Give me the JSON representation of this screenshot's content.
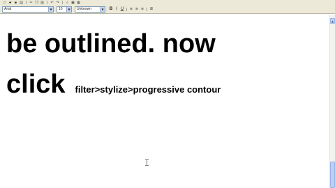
{
  "toolbar_top": {
    "buttons": [
      {
        "name": "new-icon",
        "glyph": "▭"
      },
      {
        "name": "open-icon",
        "glyph": "▰"
      },
      {
        "name": "save-icon",
        "glyph": "▪"
      },
      {
        "name": "print-icon",
        "glyph": "▤"
      },
      {
        "name": "cut-icon",
        "glyph": "✂"
      },
      {
        "name": "copy-icon",
        "glyph": "❐"
      },
      {
        "name": "paste-icon",
        "glyph": "▥"
      },
      {
        "name": "undo-icon",
        "glyph": "↶"
      },
      {
        "name": "redo-icon",
        "glyph": "↷"
      },
      {
        "name": "find-icon",
        "glyph": "⌕"
      },
      {
        "name": "image-icon",
        "glyph": "▣"
      },
      {
        "name": "table-icon",
        "glyph": "▦"
      }
    ]
  },
  "format_bar": {
    "font_value": "Arial",
    "size_value": "10",
    "color_value": "Unknown",
    "bold_label": "B",
    "italic_label": "I",
    "underline_label": "U",
    "align_left_glyph": "≡",
    "align_center_glyph": "≡",
    "align_right_glyph": "≡",
    "bullets_glyph": "☰",
    "dropdown_glyph": "▼"
  },
  "document": {
    "line1": "be outlined. now",
    "line2_big": "click",
    "line2_small": "filter>stylize>progressive contour"
  },
  "scrollbar": {
    "up_glyph": "▲"
  }
}
